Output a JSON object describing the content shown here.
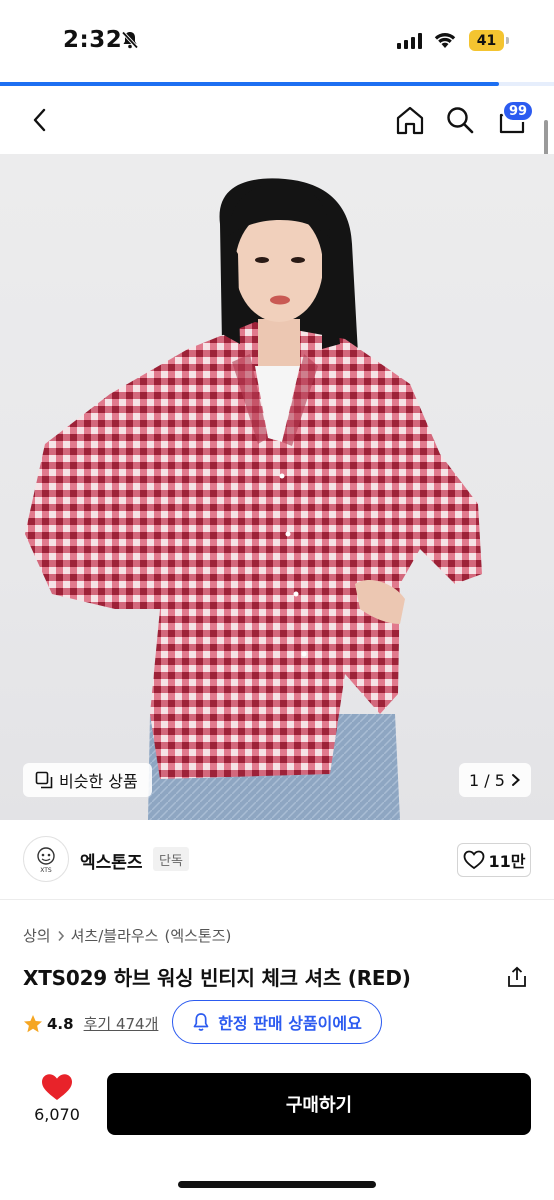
{
  "status_bar": {
    "time": "2:32",
    "battery": "41"
  },
  "load_progress": 0.9,
  "nav": {
    "cart_count": "99"
  },
  "hero": {
    "similar_label": "비슷한 상품",
    "pager": "1 / 5"
  },
  "brand": {
    "logo_text": "XTS",
    "name": "엑스톤즈",
    "tag": "단독",
    "likes": "11만"
  },
  "breadcrumb": [
    "상의",
    "셔츠/블라우스",
    "(엑스톤즈)"
  ],
  "product": {
    "title": "XTS029 하브 워싱 빈티지 체크 셔츠 (RED)",
    "rating": "4.8",
    "review_label": "후기 474개",
    "limited_label": "한정 판매 상품이에요"
  },
  "bottom": {
    "wish_count": "6,070",
    "buy_label": "구매하기"
  },
  "colors": {
    "accent": "#2c5bf0",
    "progress": "#1d6ff2",
    "heart": "#e8232a",
    "star": "#f5a623",
    "battery": "#f4c430"
  },
  "icons": [
    "back-icon",
    "home-icon",
    "search-icon",
    "cart-icon",
    "share-icon",
    "heart-icon",
    "bell-icon",
    "star-icon",
    "chevron-right-icon",
    "similar-icon"
  ]
}
